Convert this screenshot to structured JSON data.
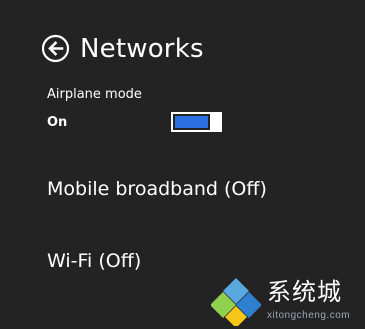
{
  "header": {
    "title": "Networks",
    "back_icon": "back-arrow-icon"
  },
  "airplane_mode": {
    "label": "Airplane mode",
    "state": "On",
    "toggle_on": true,
    "toggle_color": "#2a6fe0"
  },
  "networks": [
    {
      "label": "Mobile broadband (Off)"
    },
    {
      "label": "Wi-Fi (Off)"
    }
  ],
  "watermark": {
    "text": "系统城",
    "sub": "xitongcheng.com",
    "colors": [
      "#5aa8e0",
      "#2f7fd0",
      "#8fd14f",
      "#f5c518"
    ]
  }
}
